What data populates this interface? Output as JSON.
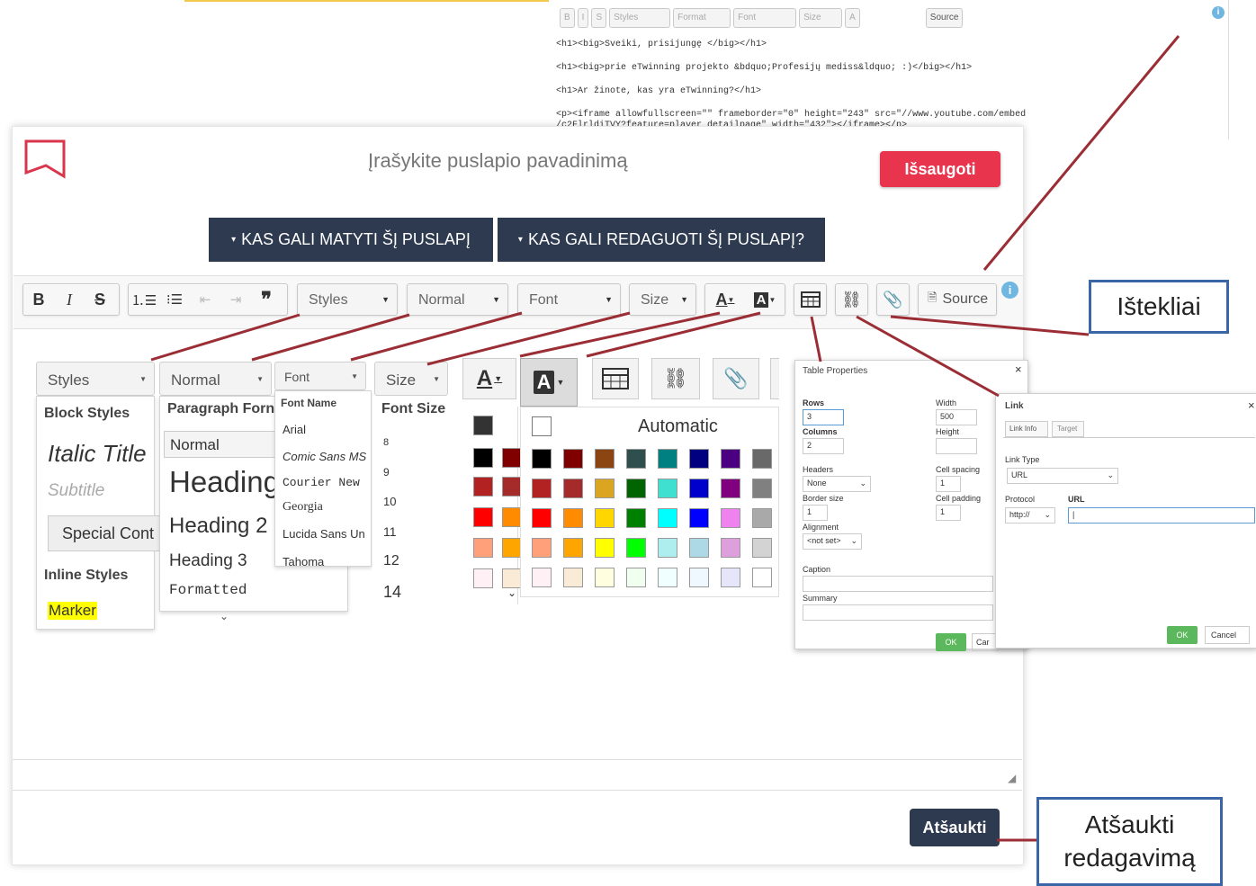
{
  "source_panel": {
    "toolbar": [
      "B",
      "I",
      "S",
      "Styles",
      "Format",
      "Font",
      "Size",
      "A",
      "Source"
    ],
    "code_lines": [
      "<h1><big>Sveiki, prisijungę </big></h1>",
      "<h1><big>prie eTwinning projekto &bdquo;Profesijų mediss&ldquo; :)</big></h1>",
      "<h1>Ar žinote, kas yra eTwinning?</h1>",
      "<p><iframe allowfullscreen=\"\" frameborder=\"0\" height=\"243\" src=\"//www.youtube.com/embed",
      "/c2FlrldiTVY?feature=player_detailpage\" width=\"432\"></iframe></p>"
    ]
  },
  "header": {
    "title_placeholder": "Įrašykite puslapio pavadinimą",
    "save_label": "Išsaugoti"
  },
  "permissions": {
    "view_label": "KAS GALI MATYTI ŠĮ PUSLAPĮ",
    "edit_label": "KAS GALI REDAGUOTI ŠĮ PUSLAPĮ?"
  },
  "toolbar": {
    "bold": "B",
    "italic": "I",
    "strike": "S",
    "quote": "❞",
    "styles": "Styles",
    "format": "Normal",
    "font": "Font",
    "size": "Size",
    "text_color": "A",
    "bg_color": "A",
    "source": "Source"
  },
  "styles_dropdown": {
    "head": "Styles",
    "block_label": "Block Styles",
    "italic_title": "Italic Title",
    "subtitle": "Subtitle",
    "special": "Special Cont",
    "inline_label": "Inline Styles",
    "marker": "Marker"
  },
  "format_dropdown": {
    "head": "Normal",
    "label": "Paragraph Forn",
    "items": [
      "Normal",
      "Heading",
      "Heading 2",
      "Heading 3",
      "Formatted"
    ]
  },
  "font_dropdown": {
    "head": "Font",
    "label": "Font Name",
    "items": [
      "Arial",
      "Comic Sans MS",
      "Courier New",
      "Georgia",
      "Lucida Sans Un",
      "Tahoma"
    ]
  },
  "size_dropdown": {
    "head": "Size",
    "label": "Font Size",
    "items": [
      "8",
      "9",
      "10",
      "11",
      "12",
      "14"
    ]
  },
  "color_panel": {
    "automatic": "Automatic",
    "colors": [
      "#000000",
      "#800000",
      "#8b4513",
      "#2f4f4f",
      "#008080",
      "#000080",
      "#4b0082",
      "#696969",
      "#b22222",
      "#a52a2a",
      "#daa520",
      "#006400",
      "#40e0d0",
      "#0000cd",
      "#800080",
      "#808080",
      "#ff0000",
      "#ff8c00",
      "#ffd700",
      "#008000",
      "#00ffff",
      "#0000ff",
      "#ee82ee",
      "#a9a9a9",
      "#ffa07a",
      "#ffa500",
      "#ffff00",
      "#00ff00",
      "#afeeee",
      "#add8e6",
      "#dda0dd",
      "#d3d3d3",
      "#fff0f5",
      "#faebd7",
      "#ffffe0",
      "#f0fff0",
      "#f0ffff",
      "#f0f8ff",
      "#e6e6fa",
      "#ffffff"
    ]
  },
  "table_dialog": {
    "title": "Table Properties",
    "rows_label": "Rows",
    "rows_value": "3",
    "cols_label": "Columns",
    "cols_value": "2",
    "width_label": "Width",
    "width_value": "500",
    "height_label": "Height",
    "headers_label": "Headers",
    "headers_value": "None",
    "border_label": "Border size",
    "border_value": "1",
    "align_label": "Alignment",
    "align_value": "<not set>",
    "spacing_label": "Cell spacing",
    "spacing_value": "1",
    "padding_label": "Cell padding",
    "padding_value": "1",
    "caption_label": "Caption",
    "summary_label": "Summary",
    "ok": "OK",
    "cancel": "Car"
  },
  "link_dialog": {
    "title": "Link",
    "tab_info": "Link Info",
    "tab_target": "Target",
    "type_label": "Link Type",
    "type_value": "URL",
    "protocol_label": "Protocol",
    "protocol_value": "http://",
    "url_label": "URL",
    "ok": "OK",
    "cancel": "Cancel"
  },
  "callouts": {
    "resources": "Ištekliai",
    "cancel_edit_1": "Atšaukti",
    "cancel_edit_2": "redagavimą"
  },
  "footer": {
    "cancel_label": "Atšaukti"
  }
}
